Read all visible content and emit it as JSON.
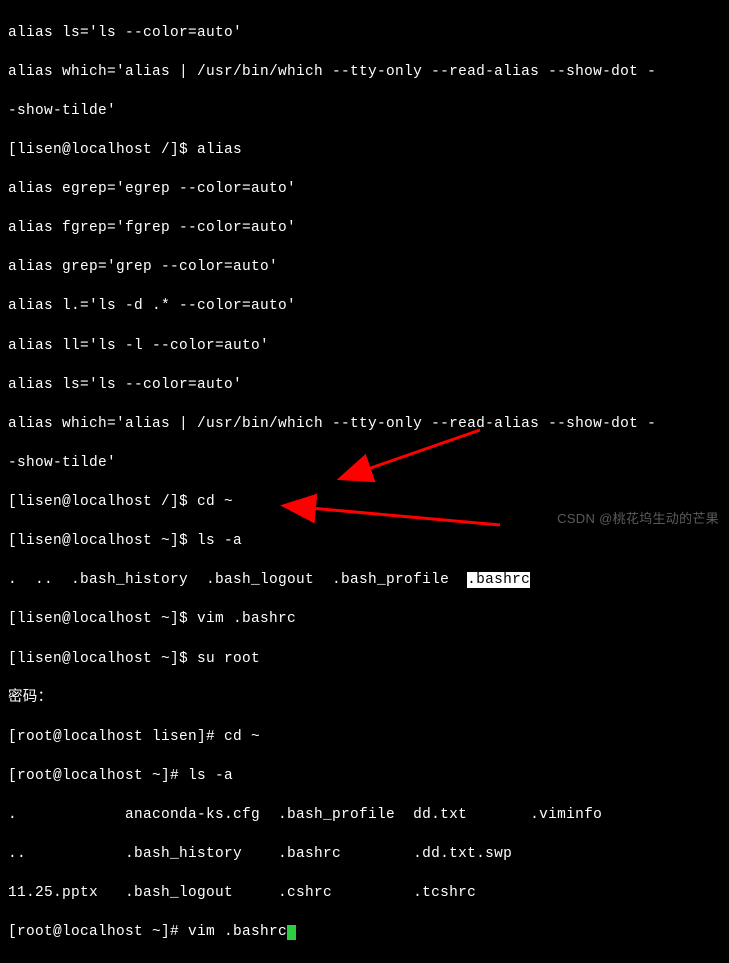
{
  "lines": {
    "l0": "alias ls='ls --color=auto'",
    "l1": "alias which='alias | /usr/bin/which --tty-only --read-alias --show-dot -",
    "l2": "-show-tilde'",
    "l3_prompt": "[lisen@localhost /]$ ",
    "l3_cmd": "alias",
    "l4": "alias egrep='egrep --color=auto'",
    "l5": "alias fgrep='fgrep --color=auto'",
    "l6": "alias grep='grep --color=auto'",
    "l7": "alias l.='ls -d .* --color=auto'",
    "l8": "alias ll='ls -l --color=auto'",
    "l9": "alias ls='ls --color=auto'",
    "l10": "alias which='alias | /usr/bin/which --tty-only --read-alias --show-dot -",
    "l11": "-show-tilde'",
    "l12_prompt": "[lisen@localhost /]$ ",
    "l12_cmd": "cd ~",
    "l13_prompt": "[lisen@localhost ~]$ ",
    "l13_cmd": "ls -a",
    "l14_a": ".  ..  .bash_history  .bash_logout  .bash_profile  ",
    "l14_hl": ".bashrc",
    "l15_prompt": "[lisen@localhost ~]$ ",
    "l15_cmd": "vim .bashrc",
    "l16_prompt": "[lisen@localhost ~]$ ",
    "l16_cmd": "su root",
    "l17": "密码：",
    "l18_prompt": "[root@localhost lisen]# ",
    "l18_cmd": "cd ~",
    "l19_prompt": "[root@localhost ~]# ",
    "l19_cmd": "ls -a",
    "l20": ".            anaconda-ks.cfg  .bash_profile  dd.txt       .viminfo",
    "l21": "..           .bash_history    .bashrc        .dd.txt.swp",
    "l22": "11.25.pptx   .bash_logout     .cshrc         .tcshrc",
    "l23_prompt": "[root@localhost ~]# ",
    "l23_cmd": "vim .bashrc"
  },
  "watermark": "CSDN @桃花坞生动的芒果"
}
